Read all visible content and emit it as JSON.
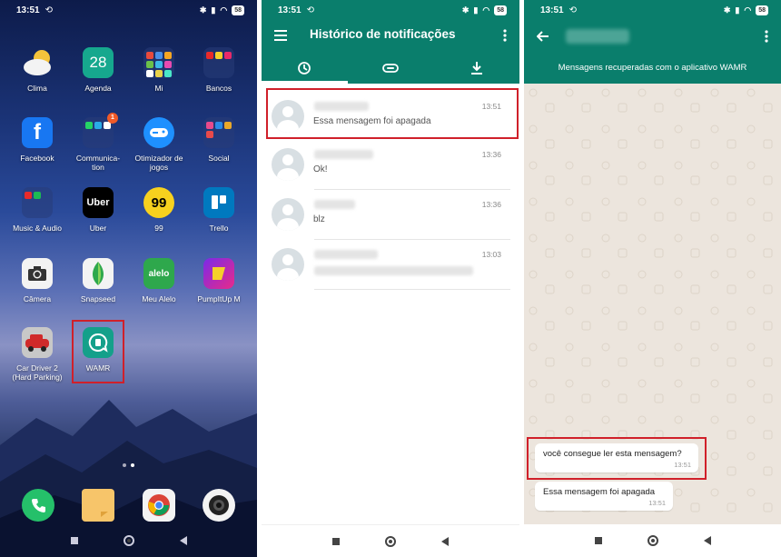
{
  "status_time": "13:51",
  "battery": "58",
  "home": {
    "apps": [
      {
        "label": "Clima",
        "icon": "weather-icon"
      },
      {
        "label": "Agenda",
        "icon": "calendar-icon",
        "value": "28"
      },
      {
        "label": "Mi",
        "icon": "folder-icon"
      },
      {
        "label": "Bancos",
        "icon": "folder-icon"
      },
      {
        "label": "Facebook",
        "icon": "facebook-icon",
        "glyph": "f"
      },
      {
        "label": "Communica-\ntion",
        "icon": "folder-icon",
        "badge": "1"
      },
      {
        "label": "Otimizador de\njogos",
        "icon": "gamepad-icon"
      },
      {
        "label": "Social",
        "icon": "folder-icon"
      },
      {
        "label": "Music & Audio",
        "icon": "folder-icon"
      },
      {
        "label": "Uber",
        "icon": "uber-icon",
        "glyph": "Uber"
      },
      {
        "label": "99",
        "icon": "ninety-nine-icon",
        "glyph": "99"
      },
      {
        "label": "Trello",
        "icon": "trello-icon"
      },
      {
        "label": "Câmera",
        "icon": "camera-icon"
      },
      {
        "label": "Snapseed",
        "icon": "snapseed-icon"
      },
      {
        "label": "Meu Alelo",
        "icon": "alelo-icon",
        "glyph": "alelo"
      },
      {
        "label": "PumpItUp M",
        "icon": "pumpitup-icon"
      },
      {
        "label": "Car Driver 2\n(Hard Parking)",
        "icon": "car-icon"
      },
      {
        "label": "WAMR",
        "icon": "wamr-icon"
      }
    ],
    "dock": [
      "phone-icon",
      "notes-icon",
      "chrome-icon",
      "camera-lens-icon"
    ]
  },
  "history": {
    "title": "Histórico de notificações",
    "tabs": [
      "history-icon",
      "attachment-icon",
      "download-icon"
    ],
    "items": [
      {
        "message": "Essa mensagem foi apagada",
        "time": "13:51"
      },
      {
        "message": "Ok!",
        "time": "13:36"
      },
      {
        "message": "blz",
        "time": "13:36"
      },
      {
        "message": "",
        "time": "13:03"
      }
    ]
  },
  "chat": {
    "banner": "Mensagens recuperadas com o aplicativo WAMR",
    "messages": [
      {
        "text": "você consegue ler esta mensagem?",
        "time": "13:51"
      },
      {
        "text": "Essa mensagem foi apagada",
        "time": "13:51"
      }
    ]
  },
  "colors": {
    "header": "#0a7e6c",
    "highlight": "#d0202a",
    "chat_bg": "#ece5dd"
  }
}
